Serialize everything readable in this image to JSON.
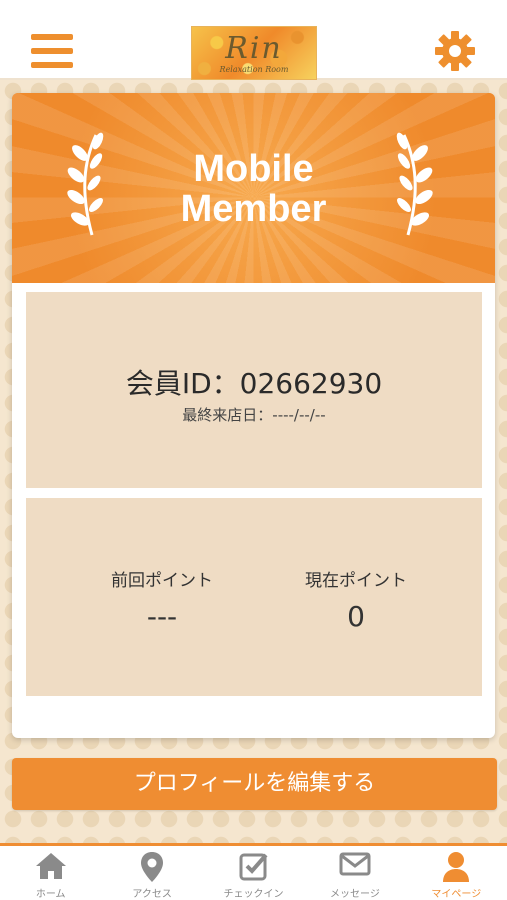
{
  "header": {
    "logo_text": "Rin",
    "logo_sub": "Relaxation Room"
  },
  "card": {
    "title_line1": "Mobile",
    "title_line2": "Member",
    "member_id_text": "会員ID：02662930",
    "last_visit_text": "最終来店日：----/--/--",
    "prev_points_label": "前回ポイント",
    "prev_points_value": "---",
    "current_points_label": "現在ポイント",
    "current_points_value": "0"
  },
  "edit_button_label": "プロフィールを編集する",
  "tabs": [
    {
      "label": "ホーム",
      "icon": "home-icon"
    },
    {
      "label": "アクセス",
      "icon": "map-pin-icon"
    },
    {
      "label": "チェックイン",
      "icon": "checkin-icon"
    },
    {
      "label": "メッセージ",
      "icon": "mail-icon"
    },
    {
      "label": "マイページ",
      "icon": "user-icon",
      "active": true
    }
  ],
  "colors": {
    "accent": "#ef8d32",
    "panel": "#efdcc4",
    "tab_inactive": "#8a8a8a"
  }
}
